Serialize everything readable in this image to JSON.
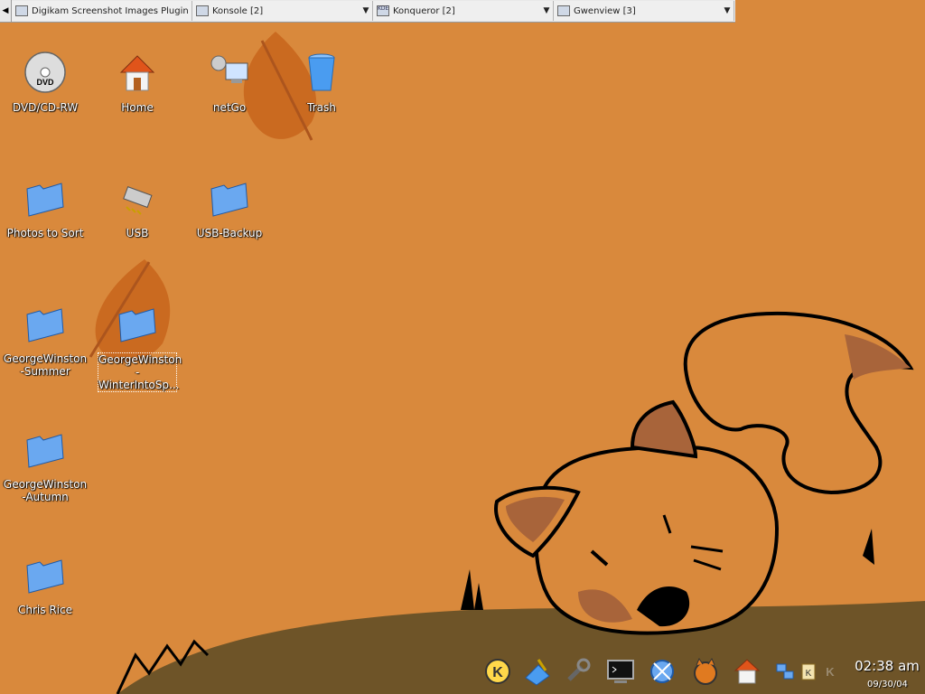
{
  "taskbar": {
    "tasks": [
      {
        "label": "Digikam Screenshot Images Plugin - D",
        "icon": "digikam-icon"
      },
      {
        "label": "Konsole [2]",
        "icon": "konsole-icon"
      },
      {
        "label": "Konqueror [2]",
        "icon": "konqueror-icon"
      },
      {
        "label": "Gwenview [3]",
        "icon": "gwenview-icon"
      }
    ]
  },
  "desktop": {
    "icons": [
      {
        "label": "DVD/CD-RW",
        "icon": "dvd-icon"
      },
      {
        "label": "Home",
        "icon": "home-icon"
      },
      {
        "label": "netGo",
        "icon": "network-icon"
      },
      {
        "label": "Trash",
        "icon": "trash-icon"
      },
      {
        "label": "Photos to Sort",
        "icon": "folder-icon"
      },
      {
        "label": "USB",
        "icon": "usb-icon"
      },
      {
        "label": "USB-Backup",
        "icon": "folder-icon"
      },
      {
        "label": "GeorgeWinston\n-Summer",
        "icon": "folder-icon"
      },
      {
        "label": "GeorgeWinston\n-WinterIntoSp...",
        "icon": "folder-icon"
      },
      {
        "label": "GeorgeWinston\n-Autumn",
        "icon": "folder-icon"
      },
      {
        "label": "Chris Rice",
        "icon": "folder-icon"
      }
    ]
  },
  "panel": {
    "clock": "02:38 am",
    "date": "09/30/04",
    "tray_letter": "K"
  },
  "colors": {
    "wallpaper": "#d9893c",
    "ground": "#6e5428",
    "fox": "#d9893c",
    "fox_dark": "#a8643a"
  }
}
